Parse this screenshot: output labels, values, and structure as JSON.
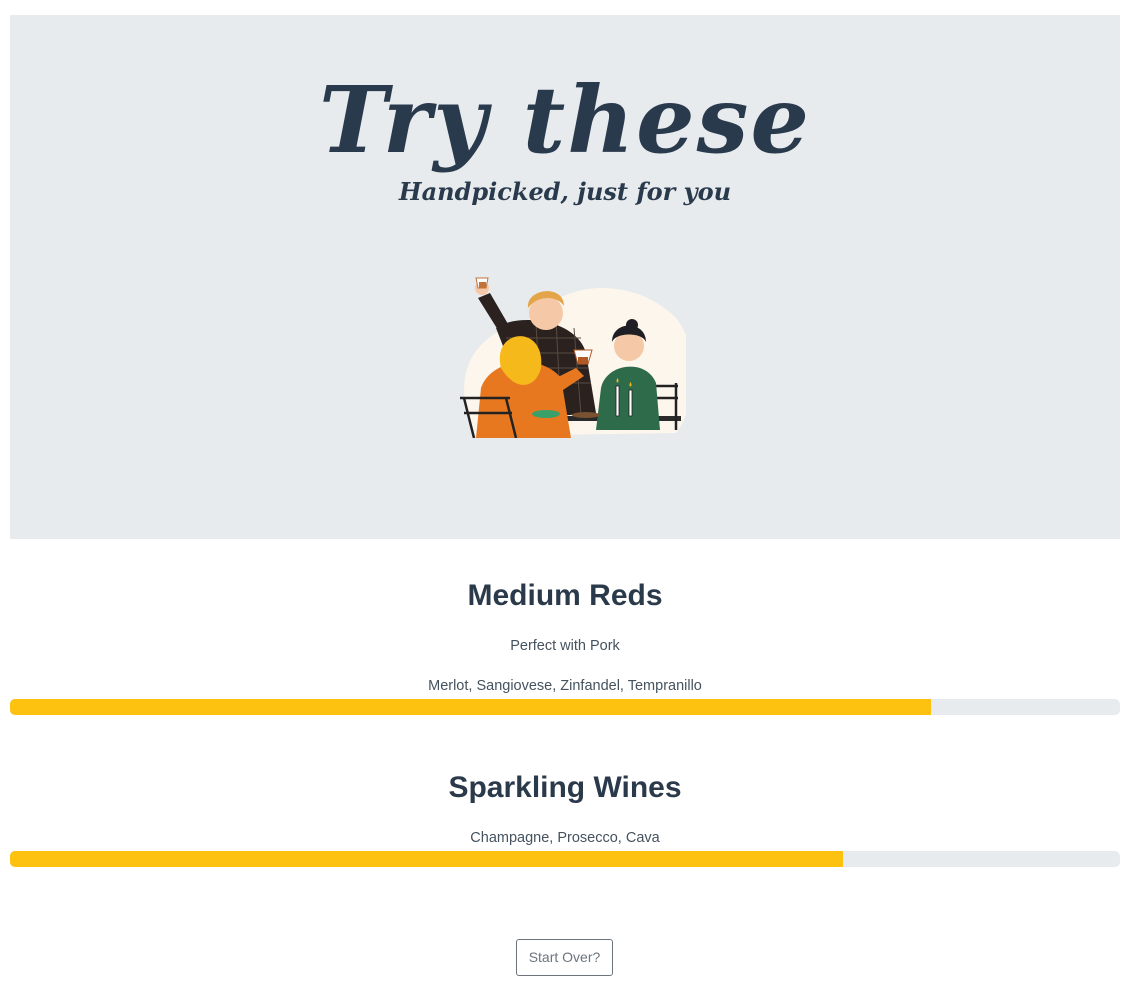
{
  "hero": {
    "title": "Try these",
    "subtitle": "Handpicked, just for you",
    "illustration_icon": "friends-toasting-wine-illustration"
  },
  "results": [
    {
      "title": "Medium Reds",
      "pairing": "Perfect with Pork",
      "varieties": "Merlot, Sangiovese, Zinfandel, Tempranillo",
      "match_percent": 83
    },
    {
      "title": "Sparkling Wines",
      "varieties": "Champagne, Prosecco, Cava",
      "match_percent": 75
    }
  ],
  "actions": {
    "start_over_label": "Start Over?"
  },
  "colors": {
    "hero_background": "#e8ebee",
    "progress_fill": "#fdc20f",
    "progress_track": "#e8ebee",
    "heading_text": "#2b3a4a"
  }
}
